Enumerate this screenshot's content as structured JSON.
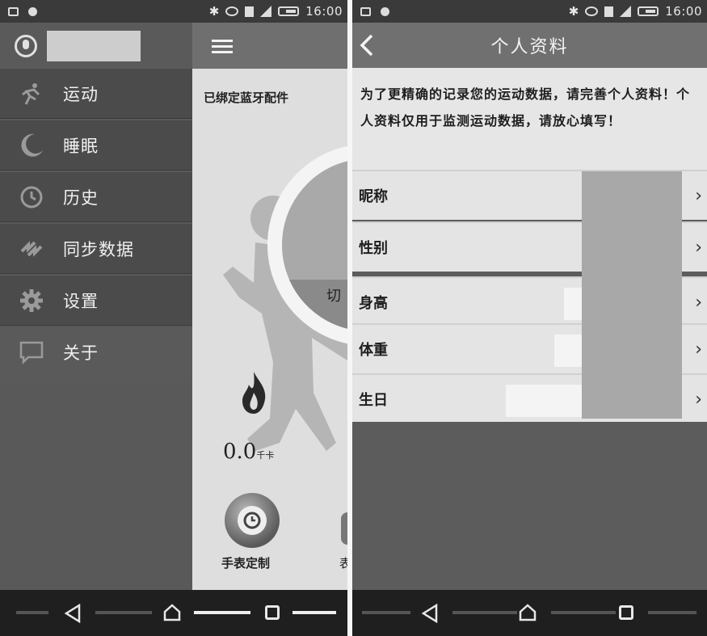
{
  "left_screen": {
    "status_bar": {
      "time": "16:00"
    },
    "content": {
      "bound_label": "已绑定蓝牙配件",
      "switch_text": "切",
      "calorie_value": "0.0",
      "calorie_unit": "千卡",
      "watch_label": "手表定制",
      "partial_label": "表"
    },
    "drawer": {
      "menu": [
        {
          "label": "运动",
          "icon": "running-icon"
        },
        {
          "label": "睡眠",
          "icon": "moon-icon"
        },
        {
          "label": "历史",
          "icon": "clock-icon"
        },
        {
          "label": "同步数据",
          "icon": "sync-icon"
        },
        {
          "label": "设置",
          "icon": "gear-icon"
        },
        {
          "label": "关于",
          "icon": "chat-bubble-icon"
        }
      ]
    }
  },
  "right_screen": {
    "status_bar": {
      "time": "16:00"
    },
    "title": "个人资料",
    "notice": "为了更精确的记录您的运动数据，请完善个人资料！个人资料仅用于监测运动数据，请放心填写！",
    "fields": [
      {
        "label": "昵称"
      },
      {
        "label": "性别"
      },
      {
        "label": "身高"
      },
      {
        "label": "体重"
      },
      {
        "label": "生日"
      }
    ],
    "chevron": "›"
  }
}
